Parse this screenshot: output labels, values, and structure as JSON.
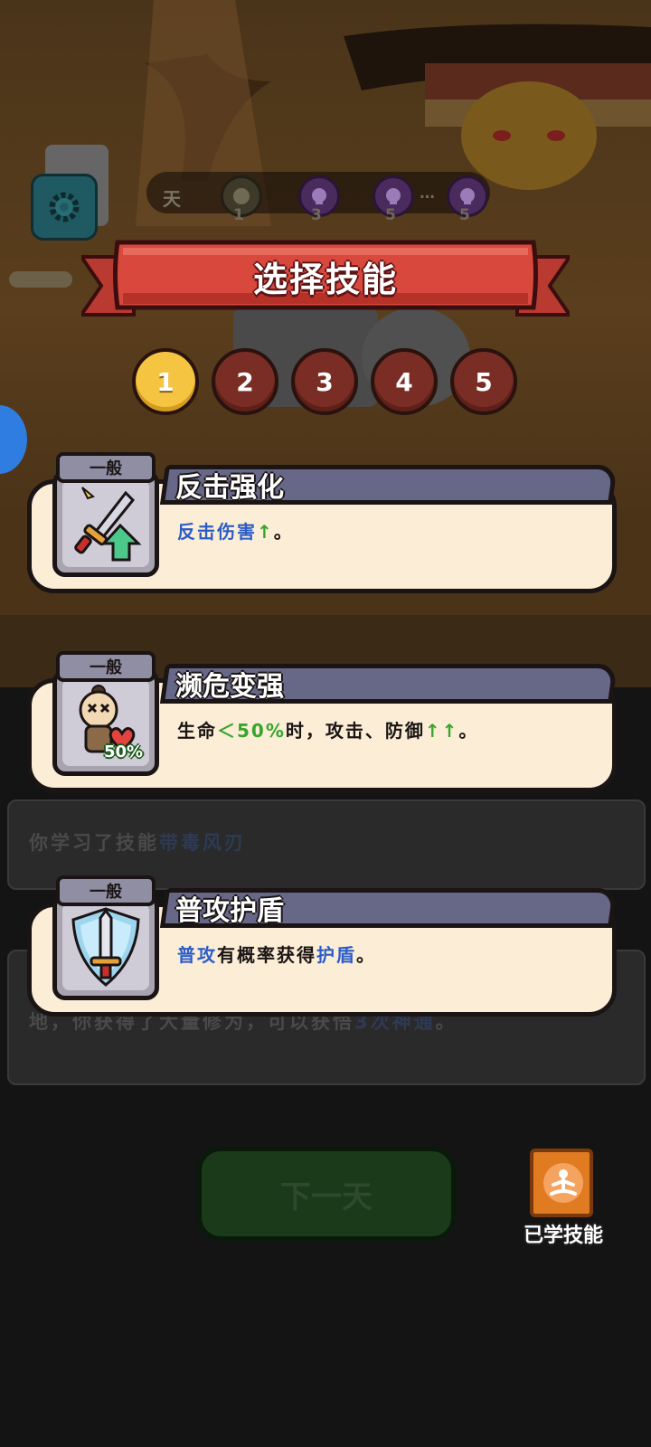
{
  "top_bar": {
    "day_label": "天",
    "day_nodes": [
      "1",
      "3",
      "5",
      "5"
    ],
    "ellipsis": "…"
  },
  "title": "选择技能",
  "pages": [
    "1",
    "2",
    "3",
    "4",
    "5"
  ],
  "active_page": "1",
  "skills": [
    {
      "rarity": "一般",
      "name": "反击强化",
      "icon": "sword-upgrade-icon",
      "desc_parts": [
        {
          "text": "反击伤害",
          "style": "blue"
        },
        {
          "text": "↑",
          "style": "green"
        },
        {
          "text": "。",
          "style": "plain"
        }
      ]
    },
    {
      "rarity": "一般",
      "name": "濒危变强",
      "icon": "low-health-doll-icon",
      "icon_badge": "50%",
      "desc_parts": [
        {
          "text": "生命",
          "style": "plain"
        },
        {
          "text": "＜50%",
          "style": "green"
        },
        {
          "text": "时，攻击、防御",
          "style": "plain"
        },
        {
          "text": "↑↑",
          "style": "green"
        },
        {
          "text": "。",
          "style": "plain"
        }
      ]
    },
    {
      "rarity": "一般",
      "name": "普攻护盾",
      "icon": "sword-shield-icon",
      "desc_parts": [
        {
          "text": "普攻",
          "style": "blue"
        },
        {
          "text": "有概率获得",
          "style": "plain"
        },
        {
          "text": "护盾",
          "style": "blue"
        },
        {
          "text": "。",
          "style": "plain"
        }
      ]
    }
  ],
  "background_log": {
    "line1_prefix": "你学习了技能",
    "line1_skill": "带毒风刃",
    "line2_prefix": "地，你获得了大量修为，可以获悟",
    "line2_highlight": "3次神通",
    "line2_suffix": "。"
  },
  "next_day_label": "下一天",
  "learned_skills_label": "已学技能",
  "colors": {
    "active_page": "#f5c542",
    "inactive_page": "#7a2d24",
    "card_bg": "#fbedd6",
    "card_header": "#676888",
    "highlight_blue": "#2c5cc8",
    "highlight_green": "#38a52c"
  }
}
